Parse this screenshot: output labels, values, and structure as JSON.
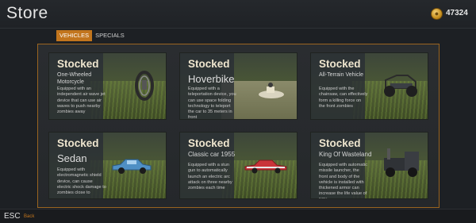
{
  "header": {
    "title": "Store",
    "coins": "47324",
    "coin_icon": "gold-coin-icon"
  },
  "tabs": [
    {
      "label": "VEHICLES",
      "active": true
    },
    {
      "label": "SPECIALS",
      "active": false
    }
  ],
  "cards": [
    {
      "status": "Stocked",
      "name": "One-Wheeled Motorcycle",
      "desc": "Equipped with an independent air wave jet device that can use air waves to push nearby zombies away"
    },
    {
      "status": "Stocked",
      "name": "Hoverbike",
      "desc": "Equipped with a teleportation device, you can use space folding technology to teleport the car to 35 meters in front"
    },
    {
      "status": "Stocked",
      "name": "All-Terrain Vehicle",
      "desc": "Equipped with the chainsaw, can effectively form a killing force on the front zombies"
    },
    {
      "status": "Stocked",
      "name": "Sedan",
      "desc": "Equipped with electromagnetic shield device, can cause electric shock damage to zombies close to"
    },
    {
      "status": "Stocked",
      "name": "Classic car 1955",
      "desc": "Equipped with a stun gun to automatically launch an electric arc attack on three nearby zombies each time"
    },
    {
      "status": "Stocked",
      "name": "King Of Wasteland",
      "desc": "Equipped with automatic missile launcher, the front and body of the vehicle is installed with thickened armor can increase the life value of 50%"
    }
  ],
  "footer": {
    "esc": "ESC",
    "back": "Back"
  },
  "colors": {
    "accent": "#c2751d",
    "panel_border": "#9a6420",
    "background": "#1d2024"
  }
}
